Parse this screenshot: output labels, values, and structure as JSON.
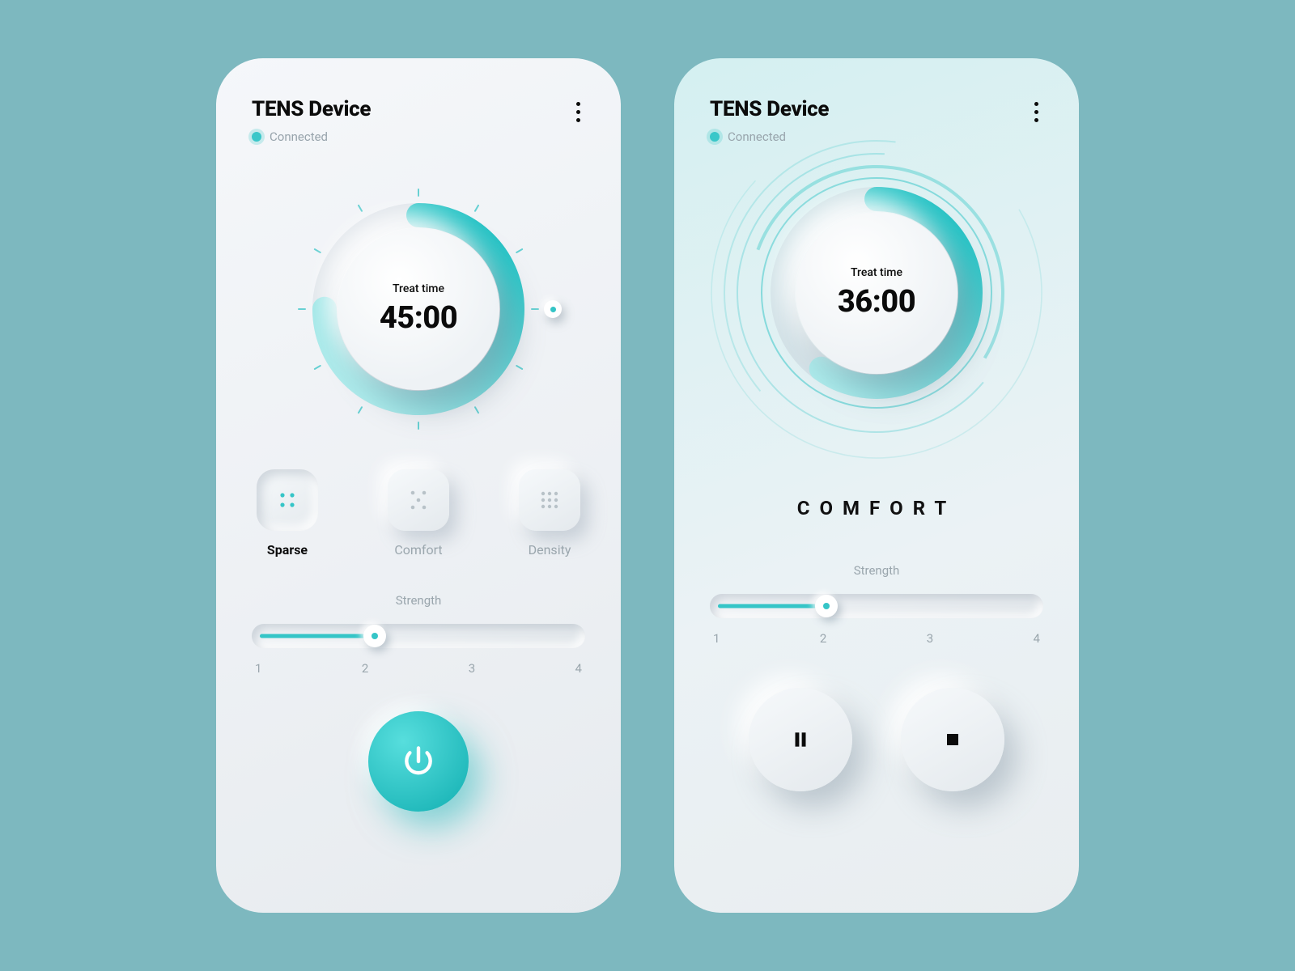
{
  "colors": {
    "accent": "#35c5c7"
  },
  "left": {
    "header": {
      "title": "TENS Device",
      "status": "Connected"
    },
    "dial": {
      "label": "Treat time",
      "value": "45:00",
      "progress_deg": 270
    },
    "modes": [
      {
        "key": "sparse",
        "label": "Sparse",
        "active": true
      },
      {
        "key": "comfort",
        "label": "Comfort",
        "active": false
      },
      {
        "key": "density",
        "label": "Density",
        "active": false
      }
    ],
    "slider": {
      "title": "Strength",
      "marks": [
        "1",
        "2",
        "3",
        "4"
      ],
      "value_percent": 37
    }
  },
  "right": {
    "header": {
      "title": "TENS Device",
      "status": "Connected"
    },
    "dial": {
      "label": "Treat time",
      "value": "36:00",
      "progress_deg": 216
    },
    "mode_label": "COMFORT",
    "slider": {
      "title": "Strength",
      "marks": [
        "1",
        "2",
        "3",
        "4"
      ],
      "value_percent": 35
    }
  }
}
